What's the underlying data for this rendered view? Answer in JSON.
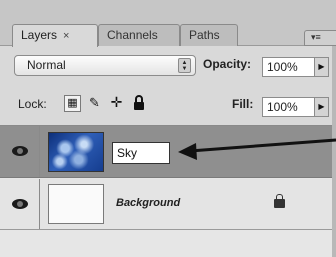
{
  "tabs": [
    {
      "label": "Layers",
      "close": "×",
      "active": true
    },
    {
      "label": "Channels",
      "active": false
    },
    {
      "label": "Paths",
      "active": false
    }
  ],
  "blend_mode": {
    "value": "Normal"
  },
  "opacity": {
    "label": "Opacity:",
    "value": "100%"
  },
  "lock": {
    "label": "Lock:"
  },
  "fill": {
    "label": "Fill:",
    "value": "100%"
  },
  "layers": [
    {
      "name": "Sky",
      "selected": true,
      "visible": true,
      "thumbnail": "blue-sky"
    },
    {
      "name": "Background",
      "selected": false,
      "visible": true,
      "locked": true,
      "thumbnail": "white"
    }
  ],
  "icons": {
    "visibility": "eye-icon",
    "lock_transparent": "checker-icon",
    "lock_image": "brush-icon",
    "lock_position": "move-icon",
    "lock_all": "lock-icon",
    "panel_menu": "menu-icon"
  },
  "colors": {
    "selected_row": "#8f8f8f",
    "panel_bg": "#d9d9d9",
    "annotation_arrow": "#111111"
  }
}
